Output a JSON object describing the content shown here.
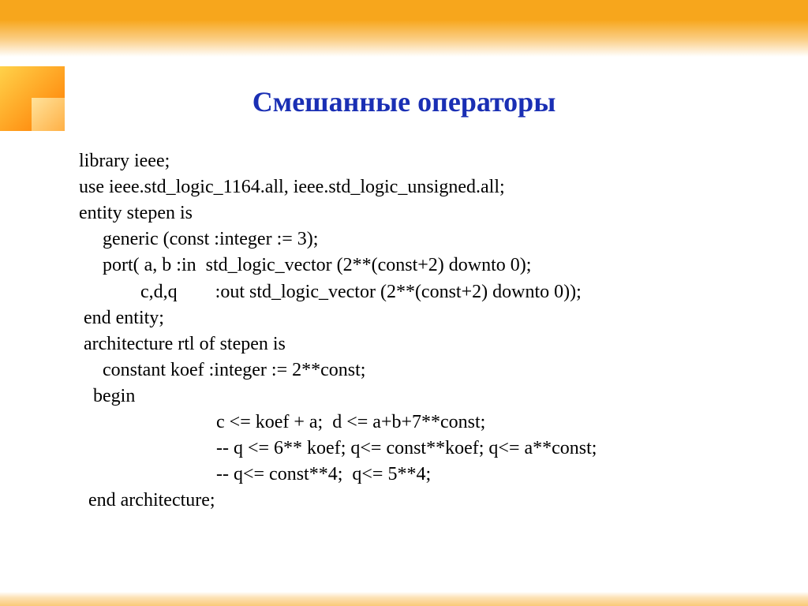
{
  "slide": {
    "title": "Смешанные операторы",
    "code_lines": [
      "library ieee;",
      "use ieee.std_logic_1164.all, ieee.std_logic_unsigned.all;",
      "entity stepen is",
      "     generic (const :integer := 3);",
      "     port( a, b :in  std_logic_vector (2**(const+2) downto 0);",
      "             c,d,q        :out std_logic_vector (2**(const+2) downto 0));",
      " end entity;",
      " architecture rtl of stepen is",
      "     constant koef :integer := 2**const;",
      "   begin",
      "                             c <= koef + a;  d <= a+b+7**const;",
      "                             -- q <= 6** koef; q<= const**koef; q<= a**const;",
      "                             -- q<= const**4;  q<= 5**4;",
      "  end architecture;"
    ]
  }
}
